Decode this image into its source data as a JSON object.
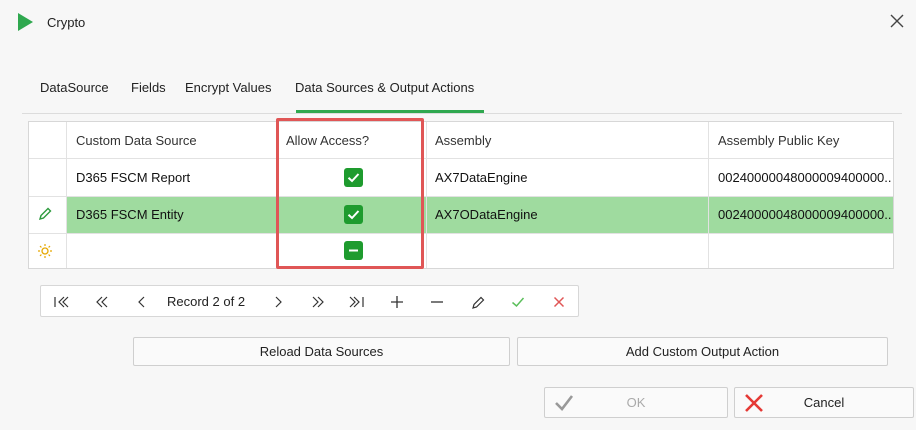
{
  "window": {
    "title": "Crypto"
  },
  "tabs": [
    {
      "label": "DataSource"
    },
    {
      "label": "Fields"
    },
    {
      "label": "Encrypt Values"
    },
    {
      "label": "Data Sources & Output Actions"
    }
  ],
  "grid": {
    "columns": [
      "Custom Data Source",
      "Allow Access?",
      "Assembly",
      "Assembly Public Key"
    ],
    "rows": [
      {
        "source": "D365 FSCM Report",
        "allow_access": "checked",
        "assembly": "AX7DataEngine",
        "public_key": "00240000048000009400000..."
      },
      {
        "source": "D365 FSCM Entity",
        "allow_access": "checked",
        "assembly": "AX7ODataEngine",
        "public_key": "00240000048000009400000..."
      },
      {
        "source": "",
        "allow_access": "indeterminate",
        "assembly": "",
        "public_key": ""
      }
    ],
    "selected_row": 2
  },
  "navigator": {
    "record_label": "Record 2 of 2",
    "buttons": [
      "first",
      "prev-page",
      "prev",
      "next",
      "next-page",
      "last",
      "add",
      "delete",
      "edit",
      "accept",
      "cancel"
    ]
  },
  "actions": {
    "reload_label": "Reload Data Sources",
    "add_output_label": "Add Custom Output Action",
    "ok_label": "OK",
    "cancel_label": "Cancel"
  },
  "colors": {
    "accent": "#2fa84f",
    "checkbox": "#1e9b2e",
    "selected_row": "#9fdb9f",
    "highlight": "#e05656",
    "cancel_icon": "#e53935"
  }
}
